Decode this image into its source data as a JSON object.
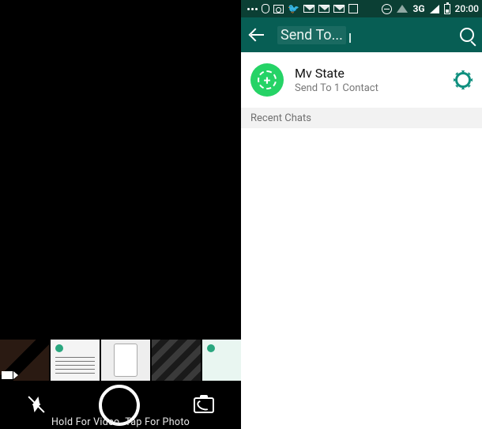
{
  "camera": {
    "hint": "Hold For Video. Tap For Photo",
    "flash": "off",
    "thumbnails": [
      "keyboard photo",
      "document screenshot",
      "phone screenshot",
      "keyboard closeup",
      "app screenshot"
    ]
  },
  "statusbar": {
    "network_label": "3G",
    "time": "20:00"
  },
  "appbar": {
    "back": "Back",
    "title": "Send To...",
    "search": "Search"
  },
  "status_row": {
    "title": "Mv State",
    "subtitle": "Send To 1 Contact",
    "settings": "Settings"
  },
  "sections": {
    "recent_chats": "Recent Chats"
  }
}
